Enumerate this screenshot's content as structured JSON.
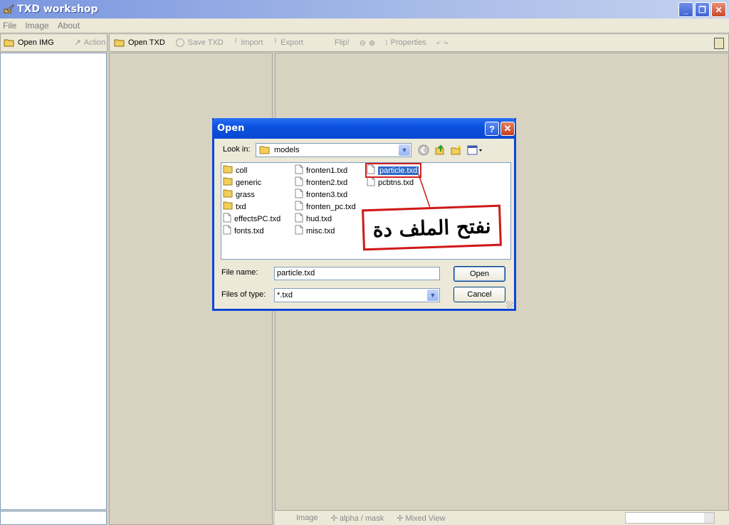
{
  "window": {
    "title": "TXD workshop",
    "minimize": "_",
    "restore": "❐",
    "close": "✕"
  },
  "menu": [
    "File",
    "Image",
    "About"
  ],
  "left_toolbar": {
    "open_img": "Open IMG",
    "action": "Action"
  },
  "main_toolbar": {
    "open_txd": "Open TXD",
    "save_txd": "Save TXD",
    "import": "Import",
    "export": "Export",
    "flip": "Flip!",
    "properties": "Properties"
  },
  "bottom_tabs": {
    "image": "Image",
    "alpha": "alpha / mask",
    "mixed": "Mixed View"
  },
  "dialog": {
    "title": "Open",
    "help": "?",
    "close": "✕",
    "look_in_label": "Look in:",
    "look_in_value": "models",
    "files_col1": [
      {
        "name": "coll",
        "type": "folder"
      },
      {
        "name": "generic",
        "type": "folder"
      },
      {
        "name": "grass",
        "type": "folder"
      },
      {
        "name": "txd",
        "type": "folder"
      },
      {
        "name": "effectsPC.txd",
        "type": "file"
      },
      {
        "name": "fonts.txd",
        "type": "file"
      }
    ],
    "files_col2": [
      {
        "name": "fronten1.txd",
        "type": "file"
      },
      {
        "name": "fronten2.txd",
        "type": "file"
      },
      {
        "name": "fronten3.txd",
        "type": "file"
      },
      {
        "name": "fronten_pc.txd",
        "type": "file"
      },
      {
        "name": "hud.txd",
        "type": "file"
      },
      {
        "name": "misc.txd",
        "type": "file"
      }
    ],
    "files_col3": [
      {
        "name": "particle.txd",
        "type": "file",
        "selected": true
      },
      {
        "name": "pcbtns.txd",
        "type": "file"
      }
    ],
    "file_name_label": "File name:",
    "file_name_value": "particle.txd",
    "file_type_label": "Files of type:",
    "file_type_value": "*.txd",
    "open_button": "Open",
    "cancel_button": "Cancel"
  },
  "annotation": {
    "text": "نفتح الملف دة",
    "color": "#d01818"
  },
  "colors": {
    "accent": "#0a46d8",
    "selection": "#316ac5",
    "annotation_border": "#d01818"
  }
}
